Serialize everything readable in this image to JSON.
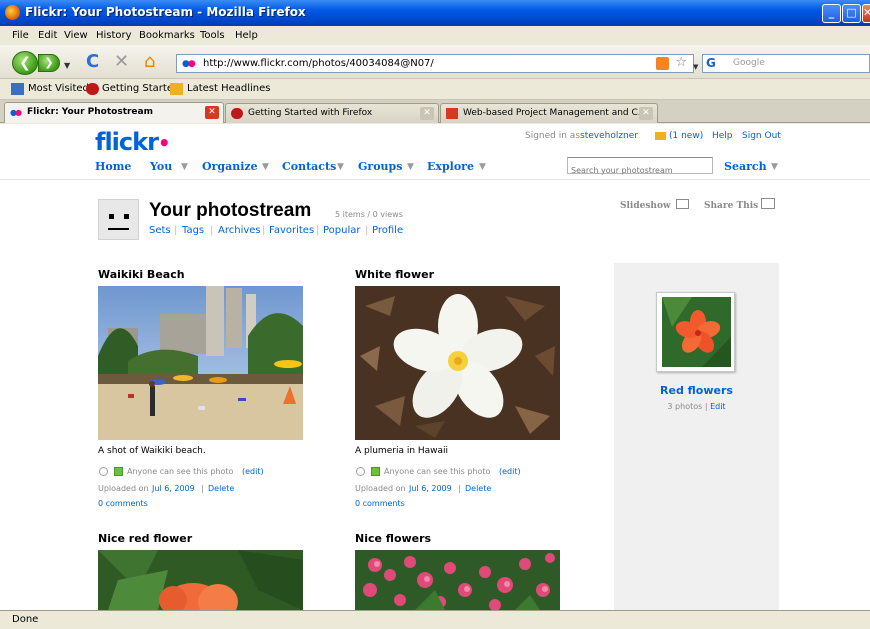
{
  "window": {
    "title": "Flickr: Your Photostream - Mozilla Firefox"
  },
  "menu": [
    "File",
    "Edit",
    "View",
    "History",
    "Bookmarks",
    "Tools",
    "Help"
  ],
  "navbar": {
    "url": "http://www.flickr.com/photos/40034084@N07/",
    "search_placeholder": "Google"
  },
  "bookmarks": [
    "Most Visited",
    "Getting Started",
    "Latest Headlines"
  ],
  "tabs": [
    {
      "label": "Flickr: Your Photostream",
      "active": true
    },
    {
      "label": "Getting Started with Firefox",
      "active": false
    },
    {
      "label": "Web-based Project Management and C...",
      "active": false
    }
  ],
  "flickr": {
    "logo": "flickr",
    "signed_in_prefix": "Signed in as",
    "username": "steveholzner",
    "mail": "(1 new)",
    "help": "Help",
    "signout": "Sign Out",
    "nav": [
      "Home",
      "You",
      "Organize",
      "Contacts",
      "Groups",
      "Explore"
    ],
    "search_placeholder": "Search your photostream",
    "search_button": "Search"
  },
  "stream": {
    "title": "Your photostream",
    "stats": "5 items / 0 views",
    "subnav": [
      "Sets",
      "Tags",
      "Archives",
      "Favorites",
      "Popular",
      "Profile"
    ],
    "slideshow": "Slideshow",
    "share": "Share This"
  },
  "photos": [
    {
      "title": "Waikiki Beach",
      "caption": "A shot of Waikiki beach.",
      "privacy": "Anyone can see this photo",
      "edit": "(edit)",
      "uploaded_prefix": "Uploaded on",
      "uploaded_date": "Jul 6, 2009",
      "delete": "Delete",
      "comments": "0 comments"
    },
    {
      "title": "White flower",
      "caption": "A plumeria in Hawaii",
      "privacy": "Anyone can see this photo",
      "edit": "(edit)",
      "uploaded_prefix": "Uploaded on",
      "uploaded_date": "Jul 6, 2009",
      "delete": "Delete",
      "comments": "0 comments"
    },
    {
      "title": "Nice red flower"
    },
    {
      "title": "Nice flowers"
    }
  ],
  "set": {
    "title": "Red flowers",
    "photos": "3 photos",
    "edit": "Edit"
  },
  "status": "Done",
  "colors": {
    "flickr_blue": "#0063dc",
    "flickr_pink": "#ff0084",
    "titlebar": "#0058e6"
  }
}
